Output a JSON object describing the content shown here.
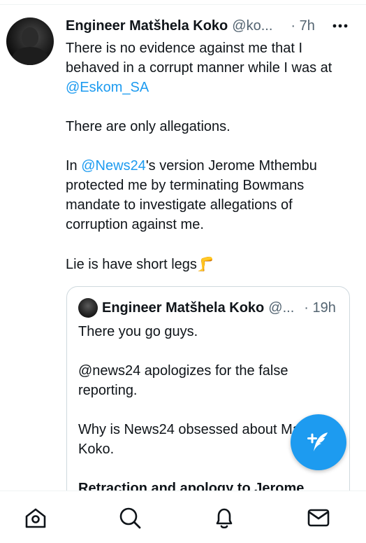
{
  "tweet": {
    "author_name": "Engineer Matšhela Koko",
    "handle": "@ko...",
    "time": "· 7h",
    "paragraphs": [
      [
        {
          "text": "There is no evidence against me that I behaved in a corrupt manner while I was at "
        },
        {
          "text": "@Eskom_SA",
          "mention": true
        }
      ],
      [
        {
          "text": "There are only allegations."
        }
      ],
      [
        {
          "text": "In "
        },
        {
          "text": "@News24",
          "mention": true
        },
        {
          "text": "'s version Jerome Mthembu protected me by terminating Bowmans mandate to investigate allegations of corruption against me."
        }
      ],
      [
        {
          "text": "Lie is have short legs"
        },
        {
          "text": "🦵",
          "emoji": true
        }
      ]
    ]
  },
  "quoted_tweet": {
    "author_name": "Engineer Matšhela Koko",
    "handle": "@...",
    "time": "· 19h",
    "paragraphs": [
      "There you go guys.",
      "@news24 apologizes for the false reporting.",
      "Why is News24 obsessed about Matshela Koko."
    ],
    "bold_paragraph": "Retraction and apology to Jerome"
  },
  "fab": {
    "icon": "compose-tweet-icon"
  },
  "nav": [
    {
      "icon": "home-icon"
    },
    {
      "icon": "explore-icon"
    },
    {
      "icon": "notifications-icon"
    },
    {
      "icon": "messages-icon"
    }
  ],
  "colors": {
    "accent": "#1d9bf0",
    "text": "#0f1419",
    "secondary": "#536471",
    "border": "#cfd9de"
  }
}
